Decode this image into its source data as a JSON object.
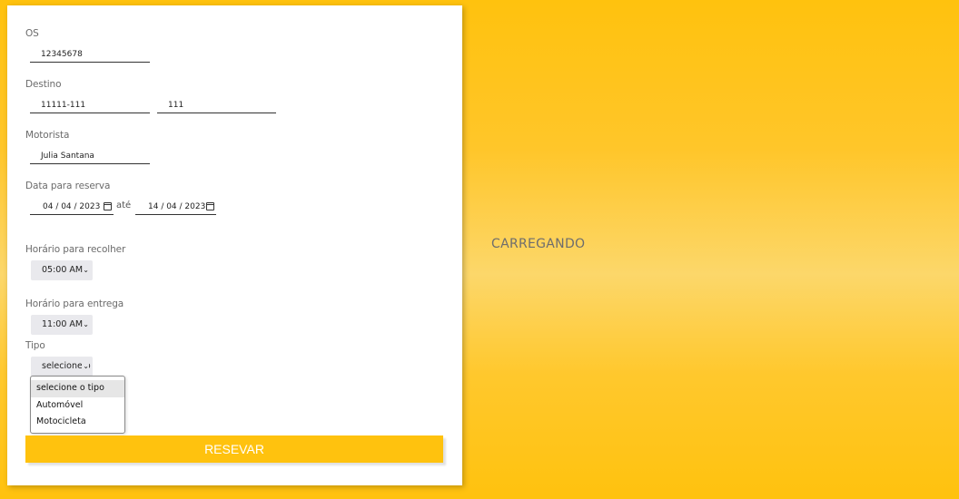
{
  "form": {
    "os_label": "OS",
    "os_value": "12345678",
    "destino_label": "Destino",
    "destino_cep": "11111-111",
    "destino_numero": "111",
    "motorista_label": "Motorista",
    "motorista_value": "Julia Santana",
    "data_label": "Data para reserva",
    "data_inicio": "04 / 04 / 2023",
    "data_ate": "até",
    "data_fim": "14 / 04 / 2023",
    "recolher_label": "Horário para recolher",
    "recolher_value": "05:00 AM",
    "entrega_label": "Horário para entrega",
    "entrega_value": "11:00 AM",
    "tipo_label": "Tipo",
    "tipo_value": "selecione o tipo",
    "tipo_options": [
      "selecione o tipo",
      "Automóvel",
      "Motocicleta"
    ],
    "submit_label": "RESEVAR"
  },
  "status": {
    "loading_text": "CARREGANDO"
  },
  "colors": {
    "accent": "#ffc20e",
    "select_bg": "#e9e9ed"
  },
  "icons": {
    "calendar": "calendar-icon",
    "chevron": "chevron-down-icon"
  }
}
